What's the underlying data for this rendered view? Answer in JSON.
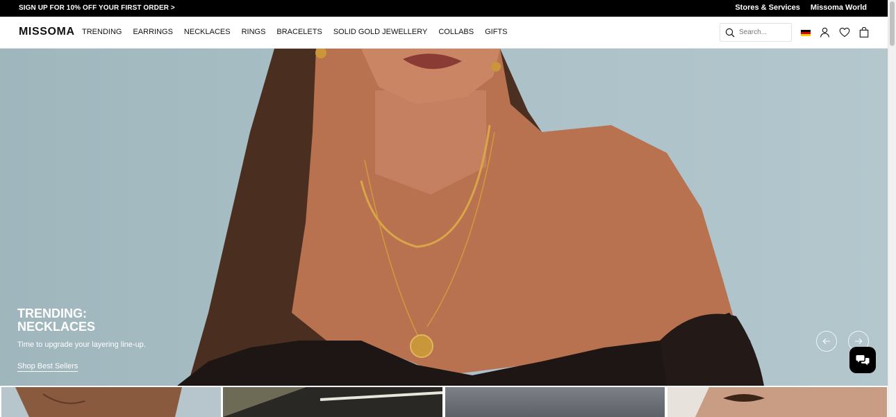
{
  "promo": {
    "text": "SIGN UP FOR 10% OFF YOUR FIRST ORDER >",
    "links": [
      "Stores & Services",
      "Missoma World"
    ]
  },
  "header": {
    "logo": "MISSOMA",
    "nav": [
      "TRENDING",
      "EARRINGS",
      "NECKLACES",
      "RINGS",
      "BRACELETS",
      "SOLID GOLD JEWELLERY",
      "COLLABS",
      "GIFTS"
    ],
    "search_placeholder": "Search...",
    "icons": [
      "flag-de-icon",
      "account-icon",
      "wishlist-heart-icon",
      "bag-icon"
    ]
  },
  "hero": {
    "title": "TRENDING: NECKLACES",
    "subtitle": "Time to upgrade your layering line-up.",
    "cta": "Shop Best Sellers",
    "colors": {
      "background": "#a9bfc6",
      "skin": "#b9724f",
      "hair": "#4a2f20",
      "dress": "#1e1614",
      "gold": "#c9963a"
    }
  },
  "colors": {
    "promo_bg": "#000000",
    "text": "#111111",
    "chat_bg": "#000000"
  }
}
